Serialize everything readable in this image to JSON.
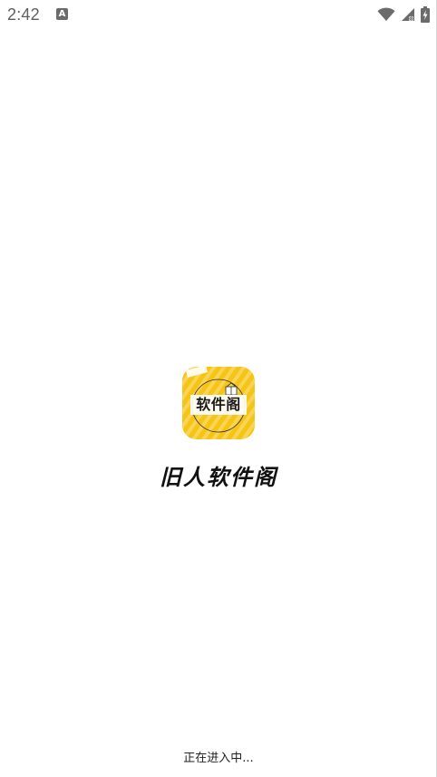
{
  "status_bar": {
    "time": "2:42",
    "notification_icon": "a-letter-icon",
    "notification_letter": "A",
    "wifi_icon": "wifi-icon",
    "signal_icon": "cell-signal-no-data-icon",
    "battery_icon": "battery-charging-icon"
  },
  "splash": {
    "logo_text": "软件阁",
    "app_name": "旧人软件阁",
    "loading_text": "正在进入中..."
  },
  "colors": {
    "logo_background": "#f6c414",
    "status_gray": "#6b6b6b",
    "text_dark": "#111111"
  }
}
